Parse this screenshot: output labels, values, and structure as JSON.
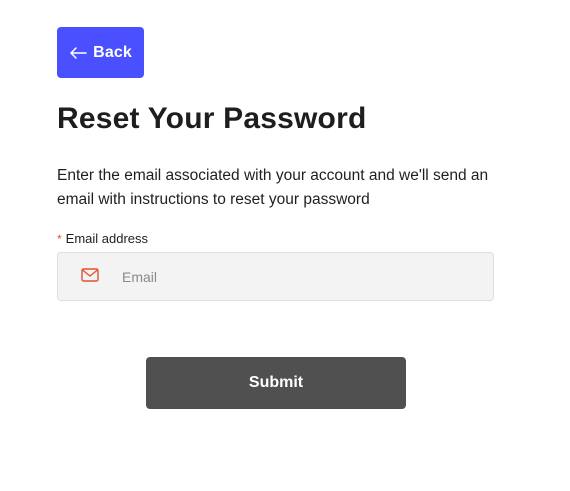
{
  "back_button": {
    "label": "Back",
    "icon": "arrow-left-icon"
  },
  "page_title": "Reset Your Password",
  "description": "Enter the email associated with your account and we'll send an email with instructions to reset your password",
  "email_field": {
    "required_marker": "*",
    "label": "Email address",
    "placeholder": "Email",
    "value": "",
    "icon": "mail-icon"
  },
  "submit_button": {
    "label": "Submit"
  },
  "colors": {
    "accent": "#4a50ff",
    "submit_bg": "#505050",
    "icon_accent": "#e0532f",
    "input_bg": "#f3f3f3"
  }
}
